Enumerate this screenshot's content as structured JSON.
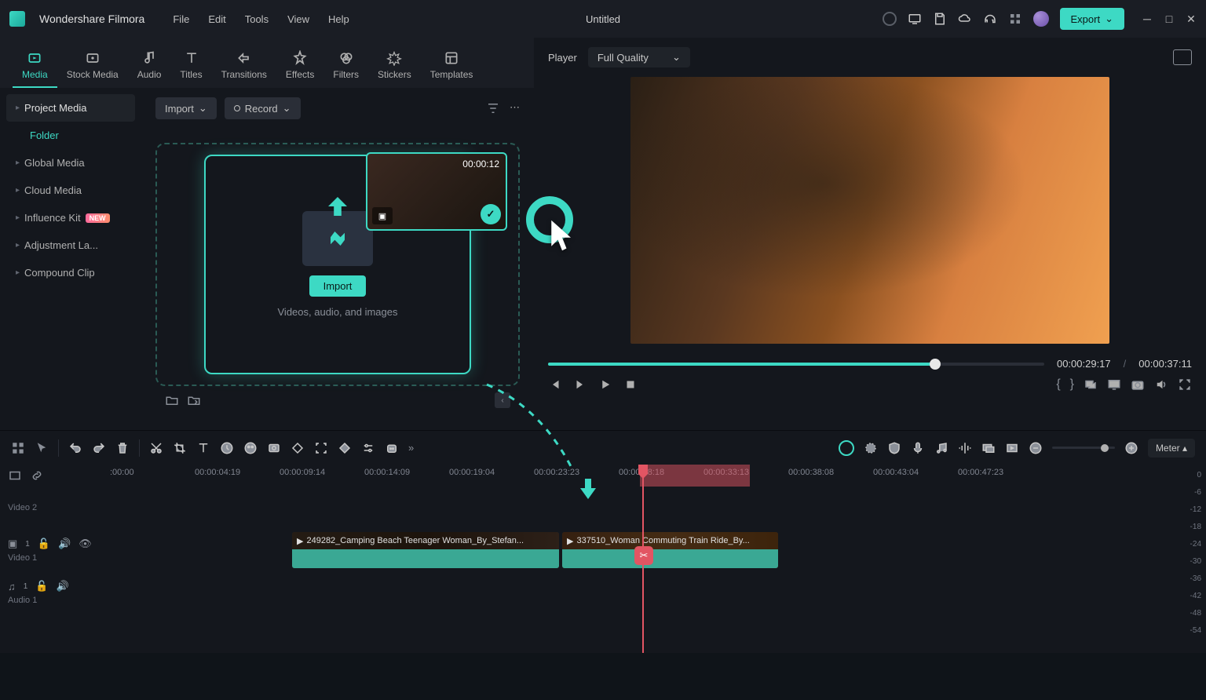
{
  "app": {
    "name": "Wondershare Filmora",
    "docTitle": "Untitled"
  },
  "menu": [
    "File",
    "Edit",
    "Tools",
    "View",
    "Help"
  ],
  "export": "Export",
  "tabs": [
    {
      "id": "media",
      "label": "Media",
      "active": true
    },
    {
      "id": "stock",
      "label": "Stock Media"
    },
    {
      "id": "audio",
      "label": "Audio"
    },
    {
      "id": "titles",
      "label": "Titles"
    },
    {
      "id": "transitions",
      "label": "Transitions"
    },
    {
      "id": "effects",
      "label": "Effects"
    },
    {
      "id": "filters",
      "label": "Filters"
    },
    {
      "id": "stickers",
      "label": "Stickers"
    },
    {
      "id": "templates",
      "label": "Templates"
    }
  ],
  "sidebar": {
    "items": [
      {
        "label": "Project Media",
        "selected": true
      },
      {
        "label": "Folder",
        "folder": true
      },
      {
        "label": "Global Media"
      },
      {
        "label": "Cloud Media"
      },
      {
        "label": "Influence Kit",
        "badge": "NEW"
      },
      {
        "label": "Adjustment La..."
      },
      {
        "label": "Compound Clip"
      }
    ]
  },
  "importRow": {
    "import": "Import",
    "record": "Record"
  },
  "dropZone": {
    "button": "Import",
    "hint": "Videos, audio, and images"
  },
  "thumb": {
    "time": "00:00:12"
  },
  "preview": {
    "playerLabel": "Player",
    "quality": "Full Quality",
    "currentTime": "00:00:29:17",
    "totalTime": "00:00:37:11"
  },
  "timeline": {
    "ticks": [
      {
        "pos": 0,
        "label": ":00:00"
      },
      {
        "pos": 108,
        "label": "00:00:04:19"
      },
      {
        "pos": 216,
        "label": "00:00:09:14"
      },
      {
        "pos": 324,
        "label": "00:00:14:09"
      },
      {
        "pos": 432,
        "label": "00:00:19:04"
      },
      {
        "pos": 540,
        "label": "00:00:23:23"
      },
      {
        "pos": 648,
        "label": "00:00:28:18"
      },
      {
        "pos": 756,
        "label": "00:00:33:13"
      },
      {
        "pos": 864,
        "label": "00:00:38:08"
      },
      {
        "pos": 972,
        "label": "00:00:43:04"
      },
      {
        "pos": 1080,
        "label": "00:00:47:23"
      }
    ],
    "tracks": {
      "video2": "Video 2",
      "video1": "Video 1",
      "audio1": "Audio 1"
    },
    "clips": [
      {
        "name": "249282_Camping Beach Teenager Woman_By_Stefan..."
      },
      {
        "name": "337510_Woman Commuting Train Ride_By..."
      }
    ],
    "meter": "Meter",
    "dbMarks": [
      "0",
      "-6",
      "-12",
      "-18",
      "-24",
      "-30",
      "-36",
      "-42",
      "-48",
      "-54"
    ]
  }
}
